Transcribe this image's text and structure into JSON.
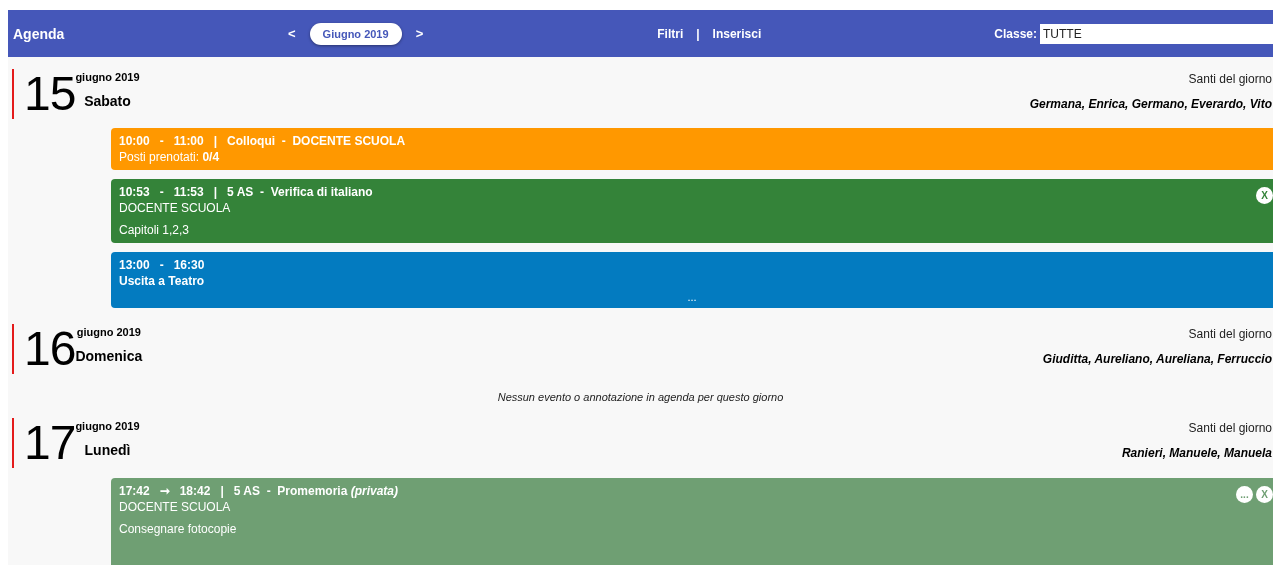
{
  "header": {
    "title": "Agenda",
    "prev": "<",
    "month": "Giugno 2019",
    "next": ">",
    "links": [
      "Filtri",
      "Inserisci"
    ],
    "separator": "|",
    "class_label": "Classe:",
    "class_value": "TUTTE"
  },
  "days": [
    {
      "number": "15",
      "month_year": "giugno 2019",
      "weekday": "Sabato",
      "saints_label": "Santi del giorno",
      "saints": "Germana, Enrica, Germano, Everardo, Vito",
      "events": [
        {
          "color": "#ff9800",
          "title": "10:00   -   11:00   |   Colloqui  -  DOCENTE SCUOLA",
          "lines": [
            {
              "kind": "normal",
              "text": "Posti prenotati: **0/4**"
            }
          ]
        },
        {
          "color": "#348339",
          "title": "10:53   -   11:53   |   5 AS  -  Verifica di italiano",
          "lines": [
            {
              "kind": "normal",
              "text": "DOCENTE SCUOLA"
            },
            {
              "kind": "note",
              "text": "Capitoli 1,2,3"
            }
          ],
          "buttons": [
            "X"
          ]
        },
        {
          "color": "#037bc0",
          "title": "13:00   -   16:30",
          "lines": [
            {
              "kind": "bold",
              "text": "Uscita a Teatro"
            }
          ],
          "more": "..."
        }
      ]
    },
    {
      "number": "16",
      "month_year": "giugno 2019",
      "weekday": "Domenica",
      "saints_label": "Santi del giorno",
      "saints": "Giuditta, Aureliano, Aureliana, Ferruccio",
      "empty_message": "Nessun evento o annotazione in agenda per questo giorno"
    },
    {
      "number": "17",
      "month_year": "giugno 2019",
      "weekday": "Lunedì",
      "saints_label": "Santi del giorno",
      "saints": "Ranieri, Manuele, Manuela",
      "events": [
        {
          "color": "#6f9f73",
          "title": "17:42   ➞   18:42   |   5 AS  -  Promemoria *(privata)*",
          "lines": [
            {
              "kind": "normal",
              "text": "DOCENTE SCUOLA"
            },
            {
              "kind": "note",
              "text": "Consegnare fotocopie"
            }
          ],
          "buttons": [
            "...",
            "X"
          ]
        }
      ]
    }
  ]
}
